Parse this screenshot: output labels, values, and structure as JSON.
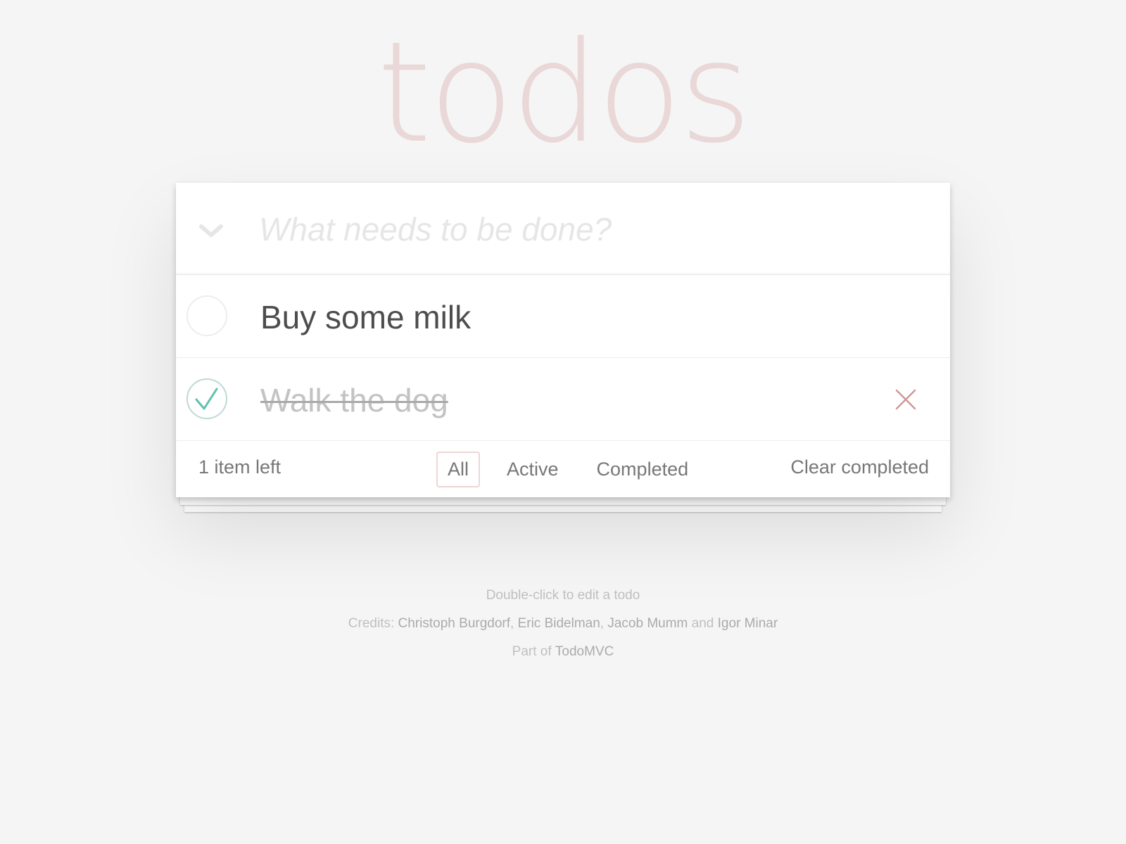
{
  "app": {
    "title": "todos"
  },
  "new_todo": {
    "placeholder": "What needs to be done?",
    "value": ""
  },
  "todos": [
    {
      "title": "Buy some milk",
      "completed": false
    },
    {
      "title": "Walk the dog",
      "completed": true
    }
  ],
  "footer": {
    "count_text": "1 item left",
    "filters": [
      {
        "label": "All",
        "selected": true
      },
      {
        "label": "Active",
        "selected": false
      },
      {
        "label": "Completed",
        "selected": false
      }
    ],
    "clear_completed_label": "Clear completed"
  },
  "info": {
    "edit_hint": "Double-click to edit a todo",
    "credits_prefix": "Credits:",
    "authors": [
      "Christoph Burgdorf",
      "Eric Bidelman",
      "Jacob Mumm",
      "Igor Minar"
    ],
    "sep_comma": ",",
    "sep_and": "and",
    "part_of_prefix": "Part of",
    "part_of_link": "TodoMVC"
  },
  "colors": {
    "background": "#f5f5f5",
    "title": "#ead7d7",
    "check": "#5dc2af",
    "destroy": "#cc9a9a",
    "selected_filter_border": "#efd5d5"
  },
  "icons": {
    "toggle_all": "chevron-down-icon",
    "toggle_unchecked": "circle-icon",
    "toggle_checked": "check-circle-icon",
    "destroy": "close-icon"
  }
}
